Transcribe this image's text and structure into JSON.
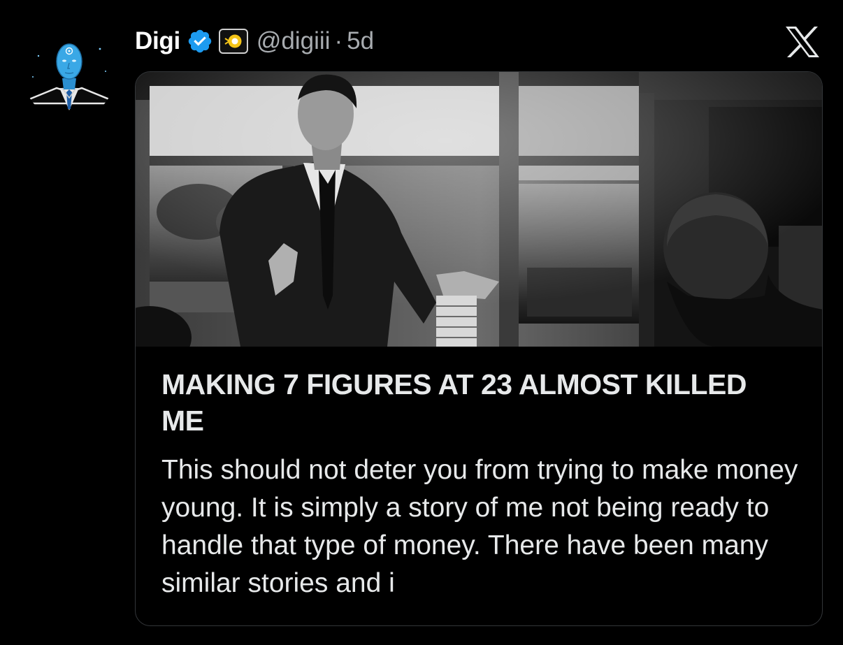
{
  "tweet": {
    "display_name": "Digi",
    "handle": "@digiii",
    "separator": "·",
    "time": "5d",
    "avatar_icon": "watchman-avatar-icon",
    "verified_icon": "verified-badge-icon",
    "affiliate_icon": "affiliate-badge-icon"
  },
  "brand": {
    "logo_icon": "x-logo-icon"
  },
  "card": {
    "title": "MAKING 7 FIGURES AT 23 ALMOST KILLED ME",
    "description": "This should not deter you from trying to make money young. It is simply a story of me not being ready to handle that type of money. There have been many similar stories and i"
  },
  "colors": {
    "background": "#000000",
    "verified_blue": "#1d9bf0",
    "text_primary": "#e7e9ea",
    "text_secondary": "#a8acb0",
    "card_border": "#333639",
    "avatar_blue": "#3aa8e6"
  }
}
